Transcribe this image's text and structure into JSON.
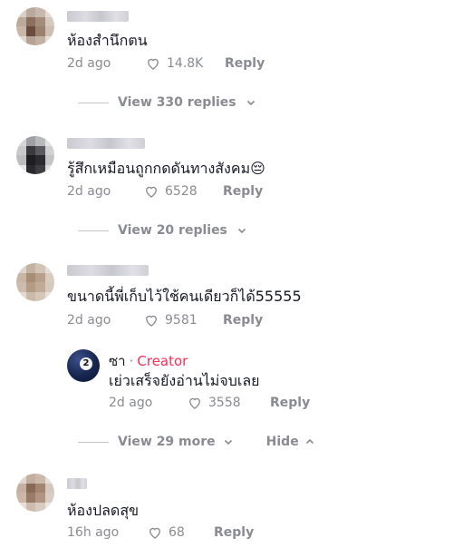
{
  "comments": [
    {
      "text": "ห้องสำนึกตน",
      "time": "2d ago",
      "likes": "14.8K",
      "reply_label": "Reply",
      "view_replies": "View 330 replies"
    },
    {
      "text": "รู้สึกเหมือนถูกกดดันทางสังคม",
      "emoji": "😔",
      "time": "2d ago",
      "likes": "6528",
      "reply_label": "Reply",
      "view_replies": "View 20 replies"
    },
    {
      "text": "ขนาดนี้พี่เก็บไว้ใช้คนเดียวก็ได้55555",
      "time": "2d ago",
      "likes": "9581",
      "reply_label": "Reply",
      "creator_reply": {
        "name": "ซา",
        "separator": "·",
        "badge": "Creator",
        "text": "เย่วเสร็จยังอ่านไม่จบเลย",
        "time": "2d ago",
        "likes": "3558",
        "reply_label": "Reply"
      },
      "view_more": "View 29 more",
      "hide_label": "Hide"
    },
    {
      "text": "ห้องปลดสุข",
      "time": "16h ago",
      "likes": "68",
      "reply_label": "Reply"
    }
  ],
  "colors": {
    "accent_creator": "#fe2c55",
    "muted_text": "#8a8b91",
    "primary_text": "#161823"
  },
  "icons": {
    "like": "heart-outline-icon",
    "expand": "chevron-down-icon",
    "collapse": "chevron-up-icon",
    "creator_avatar": "billiard-ball-8-icon"
  }
}
